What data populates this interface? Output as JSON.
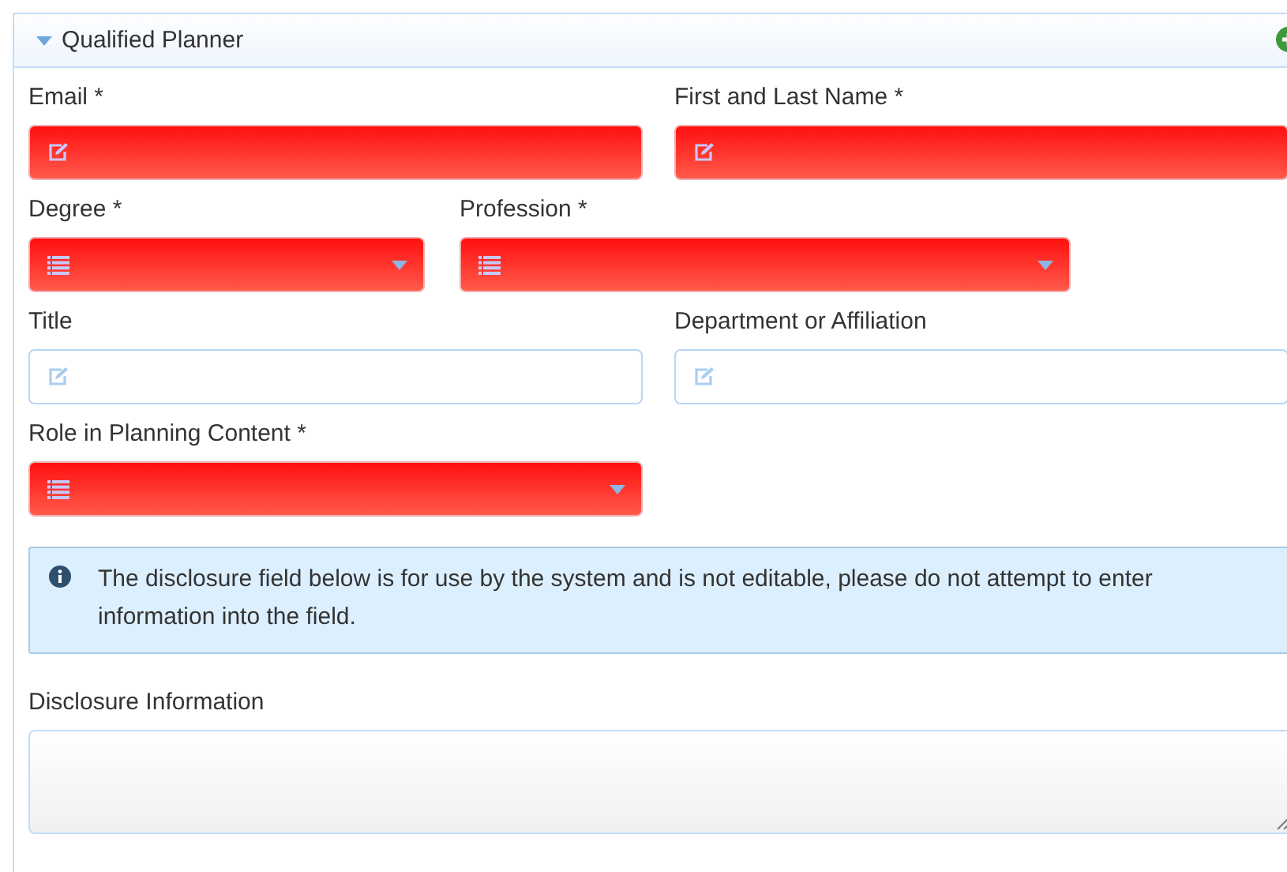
{
  "panel": {
    "title": "Qualified Planner",
    "expanded": true
  },
  "rows": [
    {
      "fields": [
        {
          "label": "Email *",
          "kind": "text",
          "invalid": true
        },
        {
          "label": "First and Last Name *",
          "kind": "text",
          "invalid": true
        }
      ]
    },
    {
      "fields": [
        {
          "label": "Degree *",
          "kind": "select",
          "invalid": true
        },
        {
          "label": "Profession *",
          "kind": "select",
          "invalid": true
        }
      ]
    },
    {
      "fields": [
        {
          "label": "Title",
          "kind": "text",
          "invalid": false
        },
        {
          "label": "Department or Affiliation",
          "kind": "text",
          "invalid": false
        }
      ]
    },
    {
      "fields": [
        {
          "label": "Role in Planning Content *",
          "kind": "select",
          "invalid": true
        }
      ]
    }
  ],
  "notice": "The disclosure field below is for use by the system and is not editable, please do not attempt to enter information into the field.",
  "disclosure": {
    "label": "Disclosure Information"
  }
}
